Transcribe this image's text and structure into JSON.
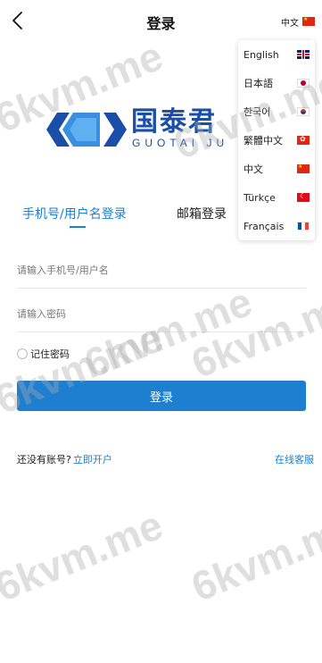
{
  "header": {
    "title": "登录",
    "back_icon": "chevron-left-icon",
    "current_language": "中文",
    "current_flag": "cn"
  },
  "language_menu": {
    "items": [
      {
        "label": "English",
        "flag": "gb"
      },
      {
        "label": "日本語",
        "flag": "jp"
      },
      {
        "label": "한국어",
        "flag": "kr"
      },
      {
        "label": "繁體中文",
        "flag": "hk"
      },
      {
        "label": "中文",
        "flag": "cn"
      },
      {
        "label": "Türkçe",
        "flag": "tr"
      },
      {
        "label": "Français",
        "flag": "fr"
      }
    ]
  },
  "logo": {
    "name_cn": "国泰君",
    "name_en": "GUOTAI JU"
  },
  "tabs": [
    {
      "label": "手机号/用户名登录",
      "active": true
    },
    {
      "label": "邮箱登录",
      "active": false
    }
  ],
  "form": {
    "phone_placeholder": "请输入手机号/用户名",
    "password_placeholder": "请输入密码",
    "remember_label": "记住密码",
    "login_button": "登录"
  },
  "footer": {
    "no_account_text": "还没有账号?",
    "register_link": "立即开户",
    "support_link": "在线客服"
  },
  "watermark": "6kvm.me",
  "colors": {
    "accent": "#1e7fd0",
    "logo_blue": "#1a4ea8"
  }
}
